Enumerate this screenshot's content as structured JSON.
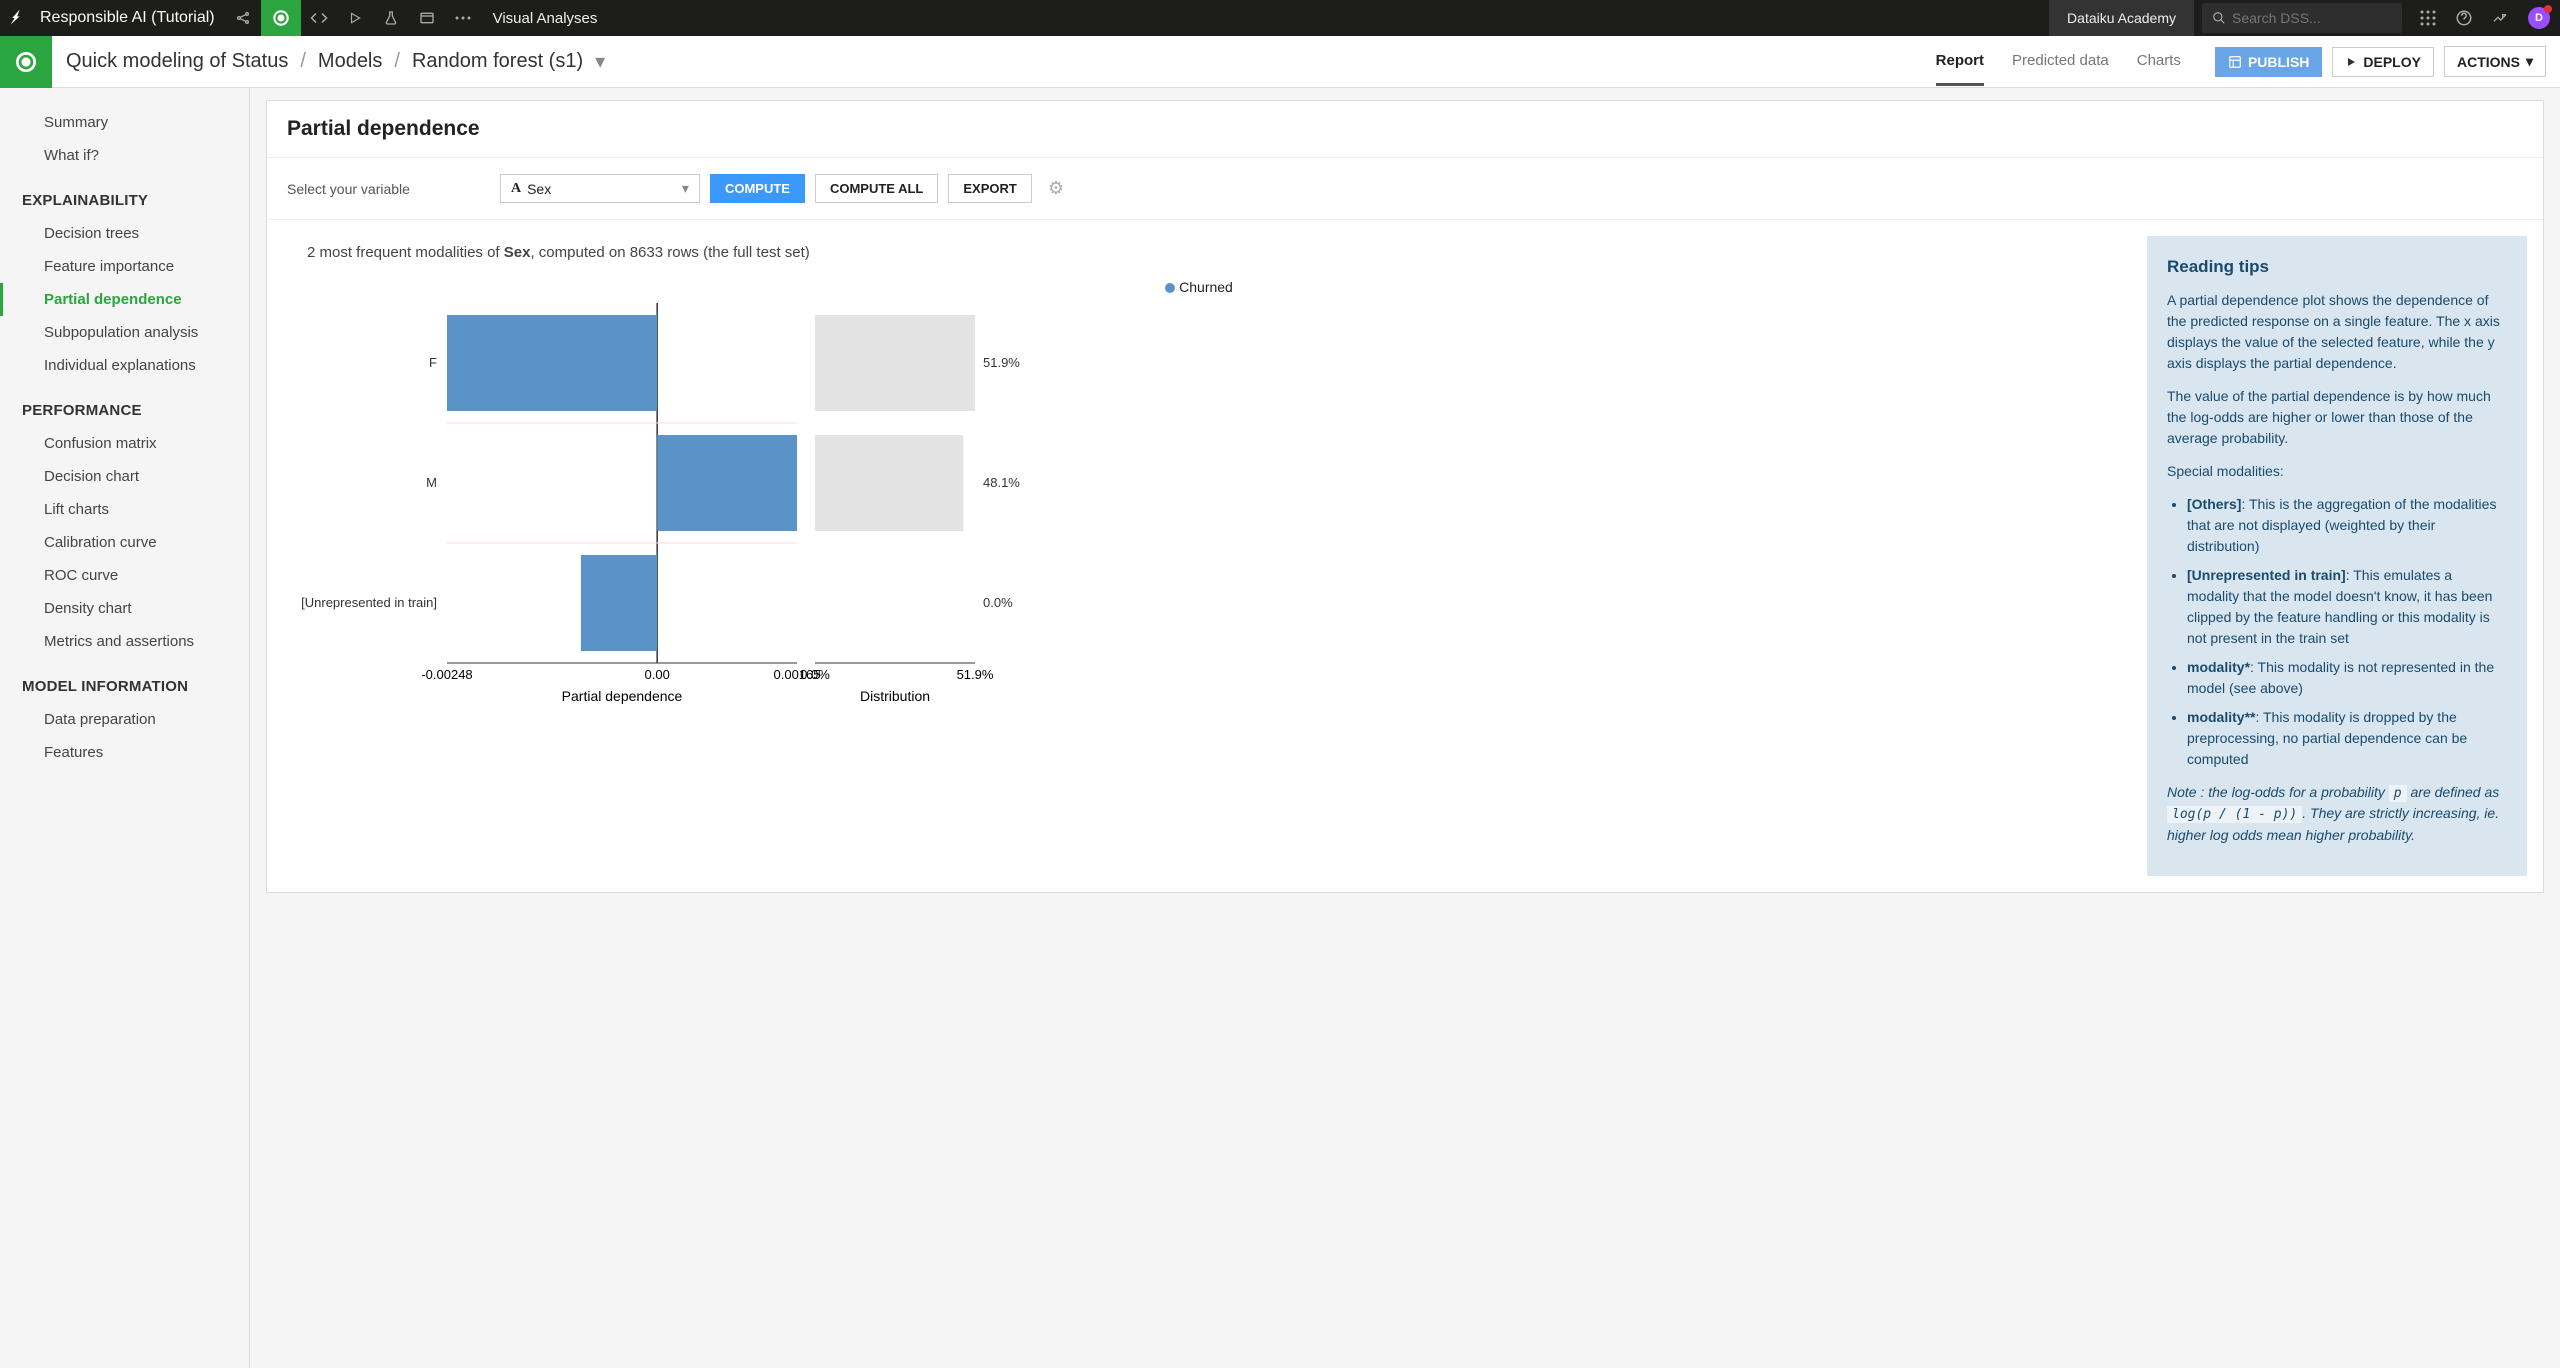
{
  "topbar": {
    "project_title": "Responsible AI (Tutorial)",
    "crumb": "Visual Analyses",
    "academy": "Dataiku Academy",
    "search_placeholder": "Search DSS...",
    "avatar_letter": "D"
  },
  "subheader": {
    "breadcrumb": [
      "Quick modeling of Status",
      "Models",
      "Random forest (s1)"
    ],
    "tabs": [
      {
        "label": "Report",
        "active": true
      },
      {
        "label": "Predicted data",
        "active": false
      },
      {
        "label": "Charts",
        "active": false
      }
    ],
    "publish": "PUBLISH",
    "deploy": "DEPLOY",
    "actions": "ACTIONS"
  },
  "sidebar": {
    "top": [
      "Summary",
      "What if?"
    ],
    "sections": [
      {
        "title": "EXPLAINABILITY",
        "items": [
          "Decision trees",
          "Feature importance",
          "Partial dependence",
          "Subpopulation analysis",
          "Individual explanations"
        ],
        "active": "Partial dependence"
      },
      {
        "title": "PERFORMANCE",
        "items": [
          "Confusion matrix",
          "Decision chart",
          "Lift charts",
          "Calibration curve",
          "ROC curve",
          "Density chart",
          "Metrics and assertions"
        ]
      },
      {
        "title": "MODEL INFORMATION",
        "items": [
          "Data preparation",
          "Features"
        ]
      }
    ]
  },
  "panel": {
    "title": "Partial dependence",
    "select_label": "Select your variable",
    "select_value": "Sex",
    "compute": "COMPUTE",
    "compute_all": "COMPUTE ALL",
    "export": "EXPORT",
    "caption_prefix": "2 most frequent modalities of ",
    "caption_bold": "Sex",
    "caption_suffix": ", computed on 8633 rows (the full test set)",
    "legend": "Churned"
  },
  "chart_data": {
    "type": "bar",
    "orientation": "horizontal",
    "categories": [
      "F",
      "M",
      "[Unrepresented in train]"
    ],
    "series": [
      {
        "name": "Partial dependence",
        "values": [
          -0.00248,
          0.00165,
          -0.0009
        ],
        "axis": "pd"
      },
      {
        "name": "Distribution",
        "values": [
          51.9,
          48.1,
          0.0
        ],
        "labels": [
          "51.9%",
          "48.1%",
          "0.0%"
        ],
        "axis": "dist"
      }
    ],
    "pd_axis": {
      "min": -0.00248,
      "zero": 0.0,
      "max": 0.00165,
      "ticks": [
        "-0.00248",
        "0.00",
        "0.00165"
      ],
      "label": "Partial dependence"
    },
    "dist_axis": {
      "min": 0.0,
      "max": 51.9,
      "ticks": [
        "0.0%",
        "51.9%"
      ],
      "label": "Distribution"
    }
  },
  "tips": {
    "title": "Reading tips",
    "p1": "A partial dependence plot shows the dependence of the predicted response on a single feature. The x axis displays the value of the selected feature, while the y axis displays the partial dependence.",
    "p2": "The value of the partial dependence is by how much the log-odds are higher or lower than those of the average probability.",
    "special": "Special modalities:",
    "bullets": [
      {
        "b": "[Others]",
        "t": ": This is the aggregation of the modalities that are not displayed (weighted by their distribution)"
      },
      {
        "b": "[Unrepresented in train]",
        "t": ": This emulates a modality that the model doesn't know, it has been clipped by the feature handling or this modality is not present in the train set"
      },
      {
        "b": "modality*",
        "t": ": This modality is not represented in the model (see above)"
      },
      {
        "b": "modality**",
        "t": ": This modality is dropped by the preprocessing, no partial dependence can be computed"
      }
    ],
    "note_prefix": "Note : the log-odds for a probability ",
    "note_p": "p",
    "note_mid": " are defined as ",
    "note_formula": "log(p / (1 - p))",
    "note_suffix": ". They are strictly increasing, ie. higher log odds mean higher probability."
  }
}
